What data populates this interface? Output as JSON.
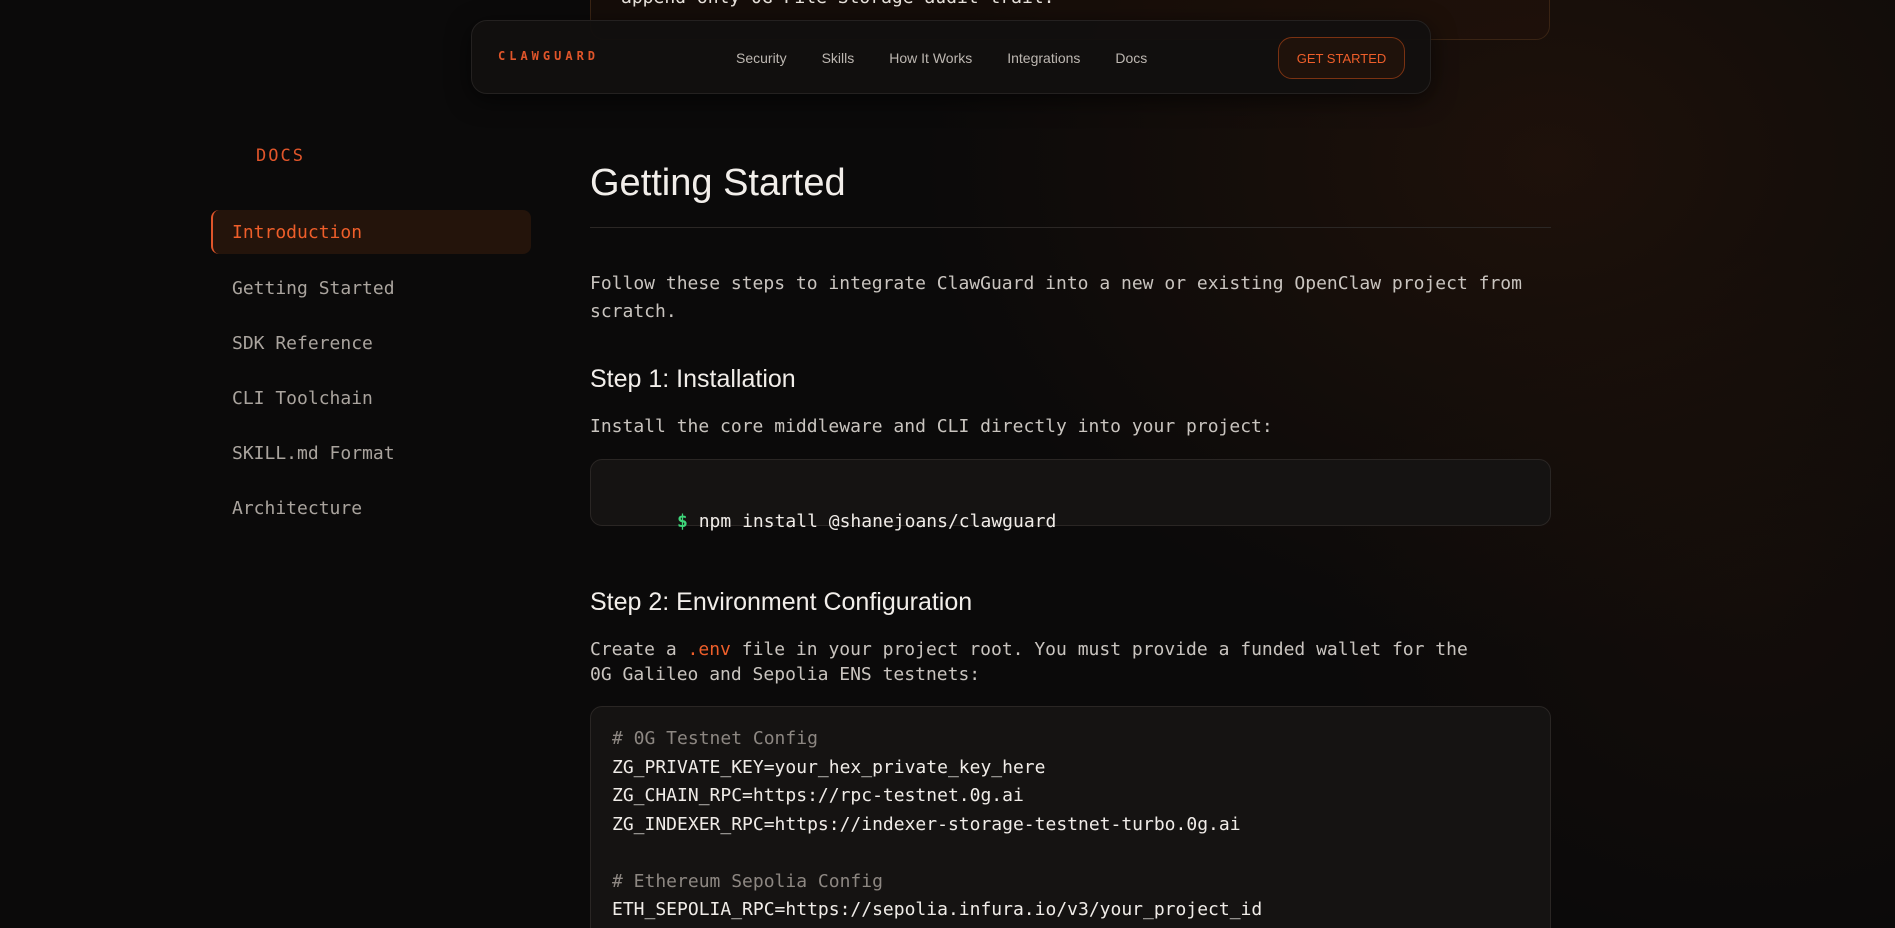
{
  "top_card": {
    "text": "append-only 0G File Storage audit trail."
  },
  "nav": {
    "brand": "CLAWGUARD",
    "links": [
      "Security",
      "Skills",
      "How It Works",
      "Integrations",
      "Docs"
    ],
    "cta": "GET STARTED"
  },
  "sidebar": {
    "title": "DOCS",
    "items": [
      {
        "label": "Introduction",
        "active": true
      },
      {
        "label": "Getting Started",
        "active": false
      },
      {
        "label": "SDK Reference",
        "active": false
      },
      {
        "label": "CLI Toolchain",
        "active": false
      },
      {
        "label": "SKILL.md Format",
        "active": false
      },
      {
        "label": "Architecture",
        "active": false
      }
    ]
  },
  "main": {
    "title": "Getting Started",
    "intro": "Follow these steps to integrate ClawGuard into a new or existing OpenClaw project from scratch.",
    "step1": {
      "heading": "Step 1: Installation",
      "text": "Install the core middleware and CLI directly into your project:",
      "prompt": "$",
      "command": "npm install @shanejoans/clawguard"
    },
    "step2": {
      "heading": "Step 2: Environment Configuration",
      "text_before": "Create a ",
      "text_highlight": ".env",
      "text_after": " file in your project root. You must provide a funded wallet for the 0G Galileo and Sepolia ENS testnets:",
      "code": {
        "comment1": "# 0G Testnet Config",
        "line1": "ZG_PRIVATE_KEY=your_hex_private_key_here",
        "line2": "ZG_CHAIN_RPC=https://rpc-testnet.0g.ai",
        "line3": "ZG_INDEXER_RPC=https://indexer-storage-testnet-turbo.0g.ai",
        "comment2": "# Ethereum Sepolia Config",
        "line4": "ETH_SEPOLIA_RPC=https://sepolia.infura.io/v3/your_project_id"
      }
    }
  },
  "colors": {
    "accent": "#e0552a",
    "prompt_green": "#3ed67a",
    "background": "#0b0a0a"
  }
}
